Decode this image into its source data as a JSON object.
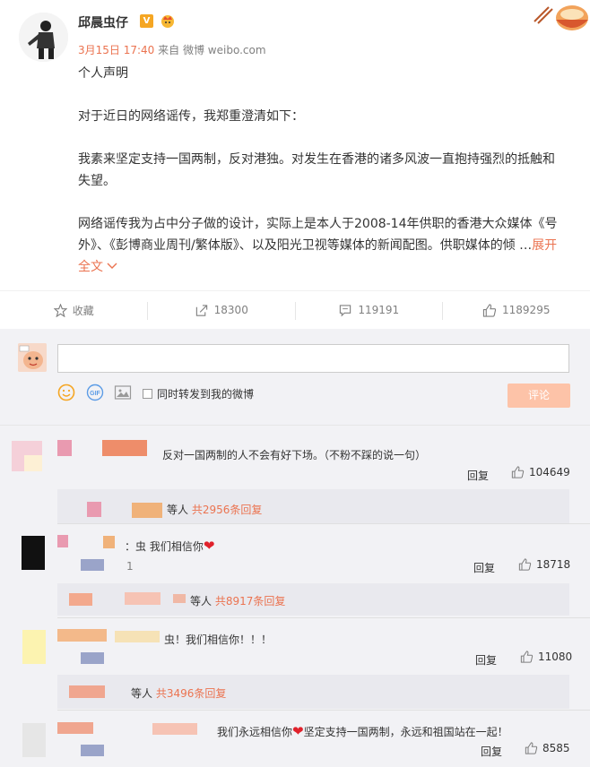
{
  "post": {
    "author": "邱晨虫仔",
    "vip_badge": "V",
    "time": "3月15日 17:40",
    "source_prefix": "来自",
    "source": "微博 weibo.com",
    "paragraphs": [
      "个人声明",
      "对于近日的网络谣传，我郑重澄清如下：",
      "我素来坚定支持一国两制，反对港独。对发生在香港的诸多风波一直抱持强烈的抵触和失望。",
      "网络谣传我为占中分子做的设计，实际上是本人于2008-14年供职的香港大众媒体《号外》、《彭博商业周刊/繁体版》、以及阳光卫视等媒体的新闻配图。供职媒体的倾 …"
    ],
    "expand_label": "展开全文",
    "expand_icon": "chevron-down-icon"
  },
  "actions": {
    "favorite_label": "收藏",
    "repost_count": "18300",
    "comment_count": "119191",
    "like_count": "1189295"
  },
  "composer": {
    "placeholder": "",
    "forward_label": "同时转发到我的微博",
    "submit_label": "评论"
  },
  "comments": [
    {
      "text": "反对一国两制的人不会有好下场。（不粉不踩的说一句）",
      "reply_label": "回复",
      "likes": "104649",
      "sub_suffix": "等人",
      "sub_count": "共2956条回复"
    },
    {
      "text_prefix": "：虫 我们相信你",
      "sub_line": "1",
      "reply_label": "回复",
      "likes": "18718",
      "sub_suffix": "等人",
      "sub_count": "共8917条回复"
    },
    {
      "text": "虫！我们相信你！！！",
      "reply_label": "回复",
      "likes": "11080",
      "sub_suffix": "等人",
      "sub_count": "共3496条回复"
    },
    {
      "text_prefix": "我们永远相信你",
      "text_suffix": "坚定支持一国两制，永远和祖国站在一起！",
      "reply_label": "回复",
      "likes": "8585"
    }
  ],
  "colors": {
    "accent": "#eb7350",
    "submit_bg": "#fdc3a8",
    "comment_bg": "#f2f2f5",
    "heart": "#e0212b"
  }
}
